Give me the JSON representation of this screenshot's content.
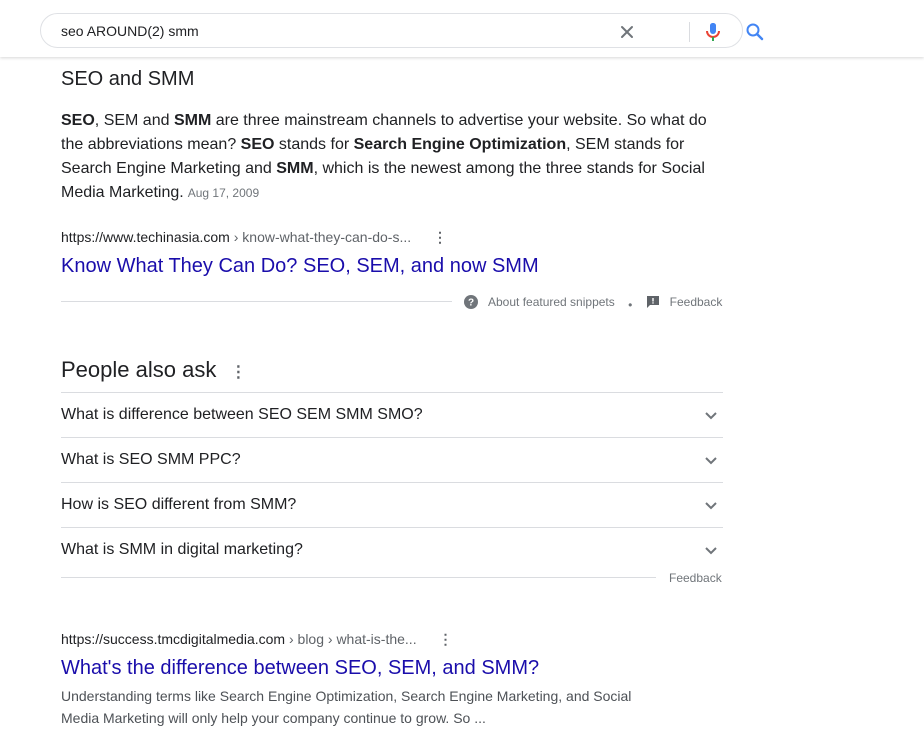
{
  "search": {
    "query": "seo AROUND(2) smm",
    "clear_icon": "close-icon",
    "mic_icon": "mic-icon",
    "search_icon": "search-icon"
  },
  "featured_snippet": {
    "heading": "SEO and SMM",
    "body": {
      "p1_b": "SEO",
      "p2": ", SEM and ",
      "p3_b": "SMM",
      "p4": " are three mainstream channels to advertise your website. So what do the abbreviations mean? ",
      "p5_b": "SEO",
      "p6": " stands for ",
      "p7_b": "Search Engine Optimization",
      "p8": ", SEM stands for Search Engine Marketing and ",
      "p9_b": "SMM",
      "p10": ", which is the newest among the three stands for Social Media Marketing."
    },
    "date": "Aug 17, 2009",
    "cite_domain": "https://www.techinasia.com",
    "cite_path": " › know-what-they-can-do-s...",
    "title": "Know What They Can Do? SEO, SEM, and now SMM",
    "about_label": "About featured snippets",
    "separator": "•",
    "feedback_label": "Feedback"
  },
  "people_also_ask": {
    "heading": "People also ask",
    "questions": [
      "What is difference between SEO SEM SMM SMO?",
      "What is SEO SMM PPC?",
      "How is SEO different from SMM?",
      "What is SMM in digital marketing?"
    ],
    "feedback_label": "Feedback"
  },
  "result": {
    "cite_domain": "https://success.tmcdigitalmedia.com",
    "cite_path": " › blog › what-is-the...",
    "title": "What's the difference between SEO, SEM, and SMM?",
    "snippet": "Understanding terms like Search Engine Optimization, Search Engine Marketing, and Social Media Marketing will only help your company continue to grow. So ..."
  },
  "colors": {
    "link": "#1a0dab",
    "search_blue": "#4285f4",
    "mic_red": "#ea4335"
  }
}
